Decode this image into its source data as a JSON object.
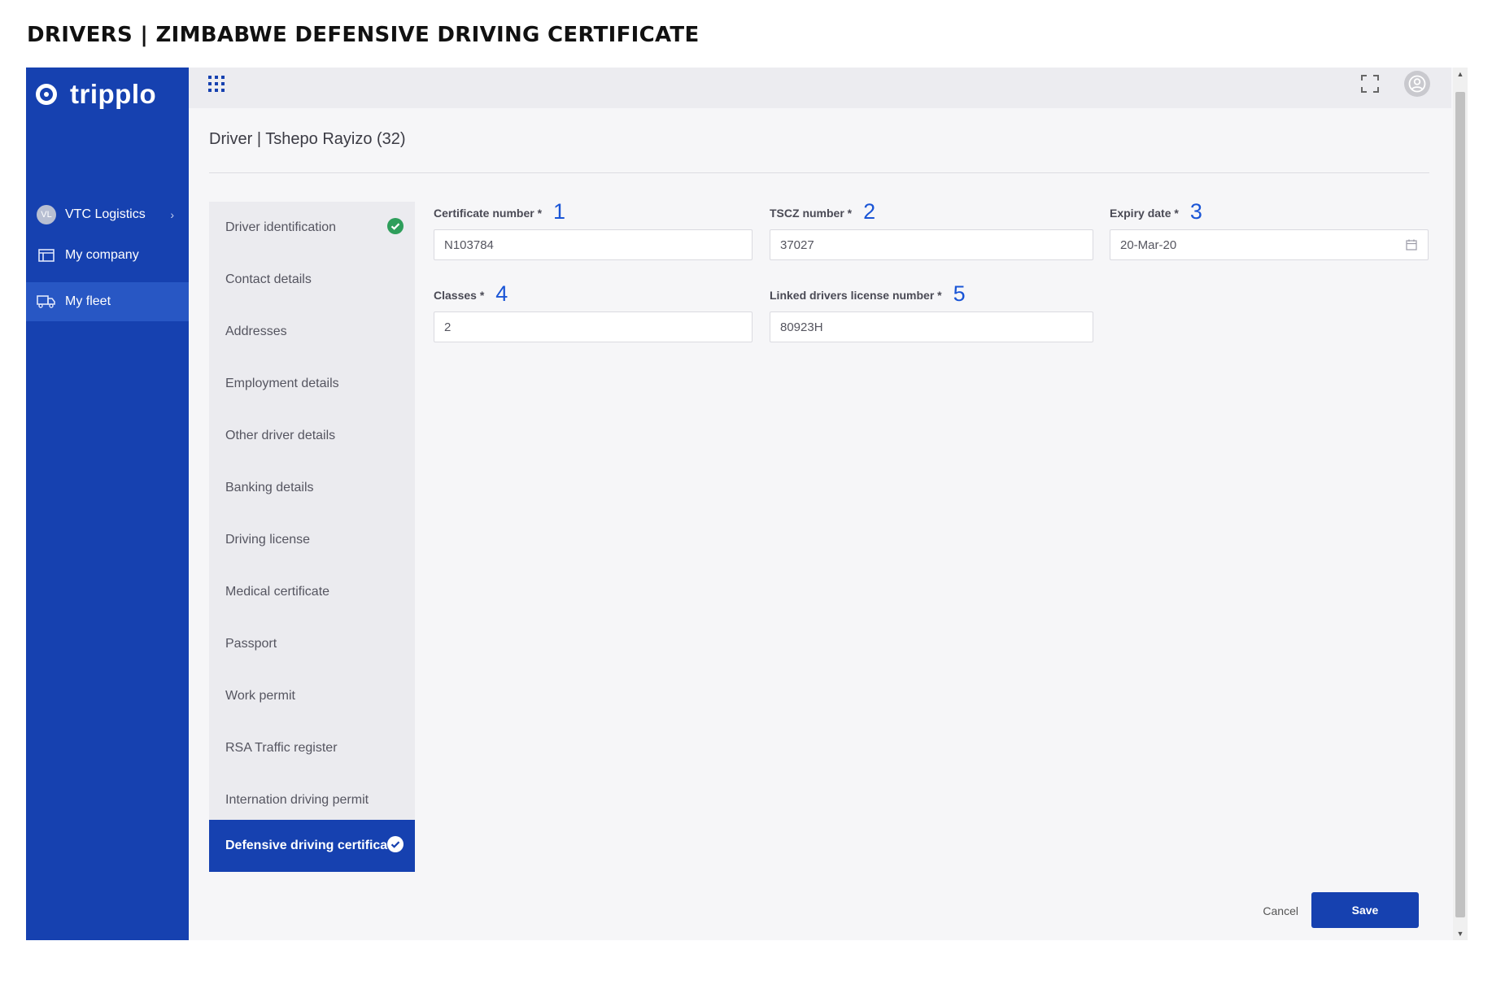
{
  "page_heading": "DRIVERS | ZIMBABWE DEFENSIVE DRIVING CERTIFICATE",
  "sidebar": {
    "logo_text": "tripplo",
    "company": {
      "avatar_initials": "VL",
      "label": "VTC Logistics",
      "chevron": "›"
    },
    "items": [
      {
        "label": "My company",
        "icon": "building-icon"
      },
      {
        "label": "My fleet",
        "icon": "truck-icon",
        "active": true
      }
    ]
  },
  "main": {
    "driver_title": "Driver | Tshepo Rayizo (32)",
    "steps": [
      {
        "label": "Driver identification",
        "completed": true
      },
      {
        "label": "Contact details"
      },
      {
        "label": "Addresses"
      },
      {
        "label": "Employment details"
      },
      {
        "label": "Other driver details"
      },
      {
        "label": "Banking details"
      },
      {
        "label": "Driving license"
      },
      {
        "label": "Medical certificate"
      },
      {
        "label": "Passport"
      },
      {
        "label": "Work permit"
      },
      {
        "label": "RSA Traffic register"
      },
      {
        "label": "Internation driving permit"
      },
      {
        "label": "Defensive driving certificate",
        "active": true,
        "completed": true
      }
    ],
    "fields": {
      "certificate_number": {
        "label": "Certificate number *",
        "value": "N103784",
        "annotation": "1"
      },
      "tscz_number": {
        "label": "TSCZ number *",
        "value": "37027",
        "annotation": "2"
      },
      "expiry_date": {
        "label": "Expiry date *",
        "value": "20-Mar-20",
        "annotation": "3"
      },
      "classes": {
        "label": "Classes *",
        "value": "2",
        "annotation": "4"
      },
      "linked_license": {
        "label": "Linked drivers license number *",
        "value": "80923H",
        "annotation": "5"
      }
    },
    "actions": {
      "cancel": "Cancel",
      "save": "Save"
    }
  },
  "colors": {
    "brand": "#1641b0",
    "annotation": "#1a55d6",
    "success": "#2e9e5b"
  }
}
